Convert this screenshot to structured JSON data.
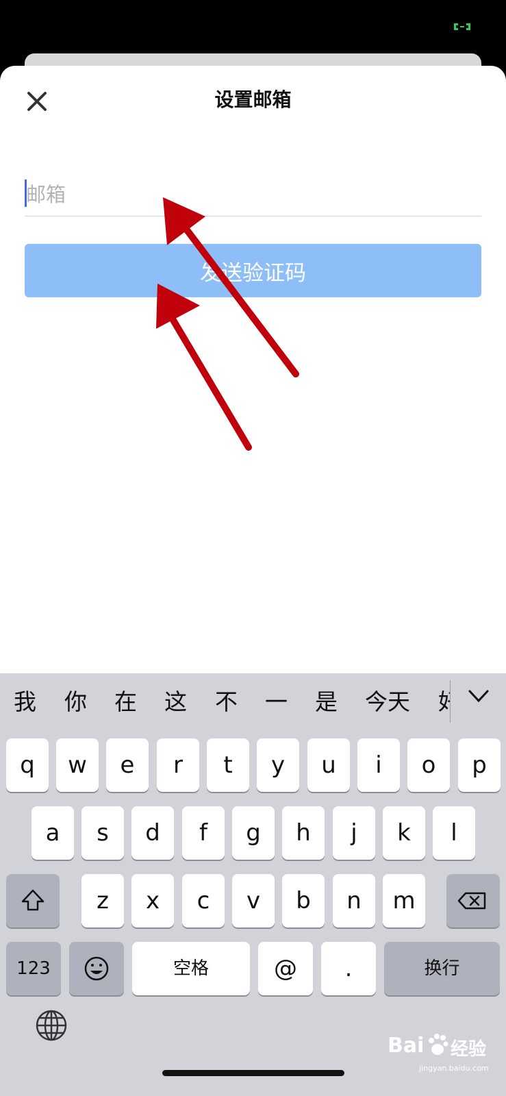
{
  "header": {
    "title": "设置邮箱"
  },
  "form": {
    "email_placeholder": "邮箱",
    "send_label": "发送验证码"
  },
  "colors": {
    "accent_button": "#8dbef7",
    "annotation_arrow": "#c0000b",
    "keyboard_bg": "#d1d3d9"
  },
  "keyboard": {
    "candidates": [
      "我",
      "你",
      "在",
      "这",
      "不",
      "一",
      "是",
      "今天",
      "好"
    ],
    "row1": [
      "q",
      "w",
      "e",
      "r",
      "t",
      "y",
      "u",
      "i",
      "o",
      "p"
    ],
    "row2": [
      "a",
      "s",
      "d",
      "f",
      "g",
      "h",
      "j",
      "k",
      "l"
    ],
    "row3": [
      "z",
      "x",
      "c",
      "v",
      "b",
      "n",
      "m"
    ],
    "num_label": "123",
    "space_label": "空格",
    "at_label": "@",
    "dot_label": ".",
    "return_label": "换行"
  },
  "watermark": {
    "brand": "Bai",
    "brand_cn": "经验",
    "url": "jingyan.baidu.com"
  }
}
